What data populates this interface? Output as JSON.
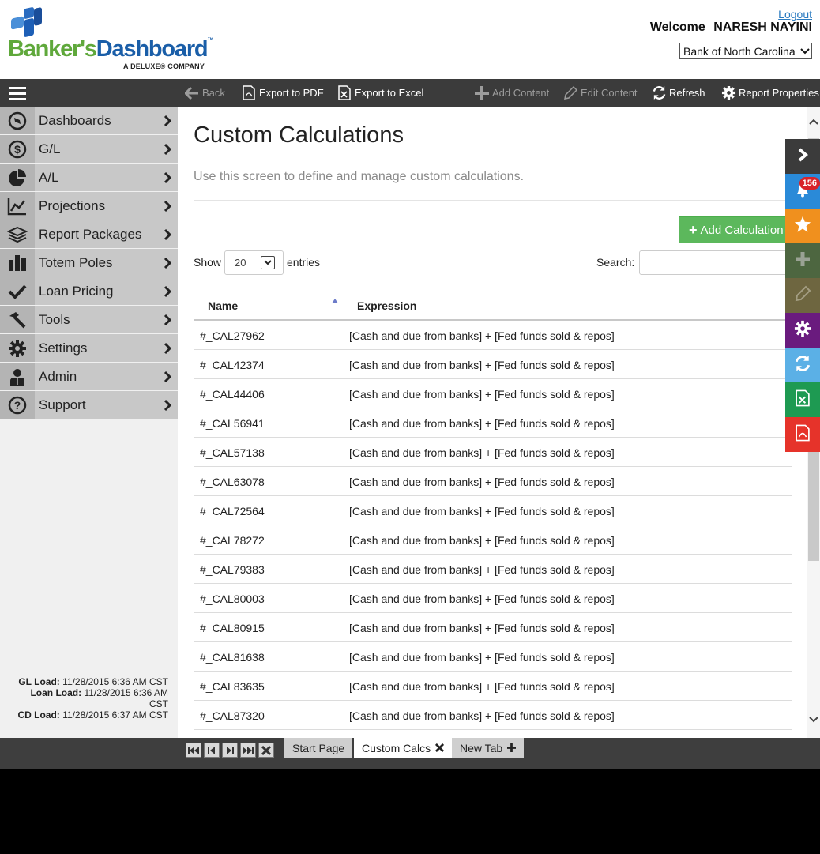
{
  "header": {
    "logo": {
      "text_a": "Banker's",
      "text_b": "Dashboard",
      "tm": "™",
      "sub": "A DELUXE® COMPANY"
    },
    "logout": "Logout",
    "welcome_label": "Welcome",
    "user_name": "NARESH NAYINI",
    "bank_selected": "Bank of North Carolina"
  },
  "toolbar": {
    "back": "Back",
    "export_pdf": "Export to PDF",
    "export_excel": "Export to Excel",
    "add_content": "Add Content",
    "edit_content": "Edit Content",
    "refresh": "Refresh",
    "report_properties": "Report Properties"
  },
  "sidebar": {
    "items": [
      {
        "label": "Dashboards",
        "icon": "compass-icon"
      },
      {
        "label": "G/L",
        "icon": "dollar-icon"
      },
      {
        "label": "A/L",
        "icon": "pie-chart-icon"
      },
      {
        "label": "Projections",
        "icon": "line-chart-icon"
      },
      {
        "label": "Report Packages",
        "icon": "layers-icon"
      },
      {
        "label": "Totem Poles",
        "icon": "bar-chart-icon"
      },
      {
        "label": "Loan Pricing",
        "icon": "checkmark-icon"
      },
      {
        "label": "Tools",
        "icon": "hammer-icon"
      },
      {
        "label": "Settings",
        "icon": "gear-icon"
      },
      {
        "label": "Admin",
        "icon": "user-icon"
      },
      {
        "label": "Support",
        "icon": "question-icon"
      }
    ],
    "loads": {
      "gl_label": "GL Load:",
      "gl_value": "11/28/2015 6:36 AM CST",
      "loan_label": "Loan Load:",
      "loan_value_1": "11/28/2015 6:36 AM",
      "loan_value_2": "CST",
      "cd_label": "CD Load:",
      "cd_value": "11/28/2015 6:37 AM CST"
    }
  },
  "main": {
    "title": "Custom Calculations",
    "description": "Use this screen to define and manage custom calculations.",
    "add_button": "Add Calculation",
    "show_label": "Show",
    "entries_value": "20",
    "entries_label": "entries",
    "search_label": "Search:",
    "search_value": "",
    "columns": {
      "name": "Name",
      "expression": "Expression"
    },
    "rows": [
      {
        "name": "#_CAL27962",
        "expression": "[Cash and due from banks] + [Fed funds sold & repos]"
      },
      {
        "name": "#_CAL42374",
        "expression": "[Cash and due from banks] + [Fed funds sold & repos]"
      },
      {
        "name": "#_CAL44406",
        "expression": "[Cash and due from banks] + [Fed funds sold & repos]"
      },
      {
        "name": "#_CAL56941",
        "expression": "[Cash and due from banks] + [Fed funds sold & repos]"
      },
      {
        "name": "#_CAL57138",
        "expression": "[Cash and due from banks] + [Fed funds sold & repos]"
      },
      {
        "name": "#_CAL63078",
        "expression": "[Cash and due from banks] + [Fed funds sold & repos]"
      },
      {
        "name": "#_CAL72564",
        "expression": "[Cash and due from banks] + [Fed funds sold & repos]"
      },
      {
        "name": "#_CAL78272",
        "expression": "[Cash and due from banks] + [Fed funds sold & repos]"
      },
      {
        "name": "#_CAL79383",
        "expression": "[Cash and due from banks] + [Fed funds sold & repos]"
      },
      {
        "name": "#_CAL80003",
        "expression": "[Cash and due from banks] + [Fed funds sold & repos]"
      },
      {
        "name": "#_CAL80915",
        "expression": "[Cash and due from banks] + [Fed funds sold & repos]"
      },
      {
        "name": "#_CAL81638",
        "expression": "[Cash and due from banks] + [Fed funds sold & repos]"
      },
      {
        "name": "#_CAL83635",
        "expression": "[Cash and due from banks] + [Fed funds sold & repos]"
      },
      {
        "name": "#_CAL87320",
        "expression": "[Cash and due from banks] + [Fed funds sold & repos]"
      }
    ]
  },
  "quick_panel": {
    "notification_count": "156",
    "colors": {
      "expand": "#3b3b3b",
      "notifications": "#2a8ad8",
      "favorites": "#f0901e",
      "add": "#4d6640",
      "edit": "#6e6640",
      "settings": "#6a1b7e",
      "refresh": "#5bb0e6",
      "excel": "#1e9a52",
      "pdf": "#e6332a"
    }
  },
  "tabs": {
    "start_page": "Start Page",
    "custom_calcs": "Custom Calcs",
    "new_tab": "New Tab"
  }
}
